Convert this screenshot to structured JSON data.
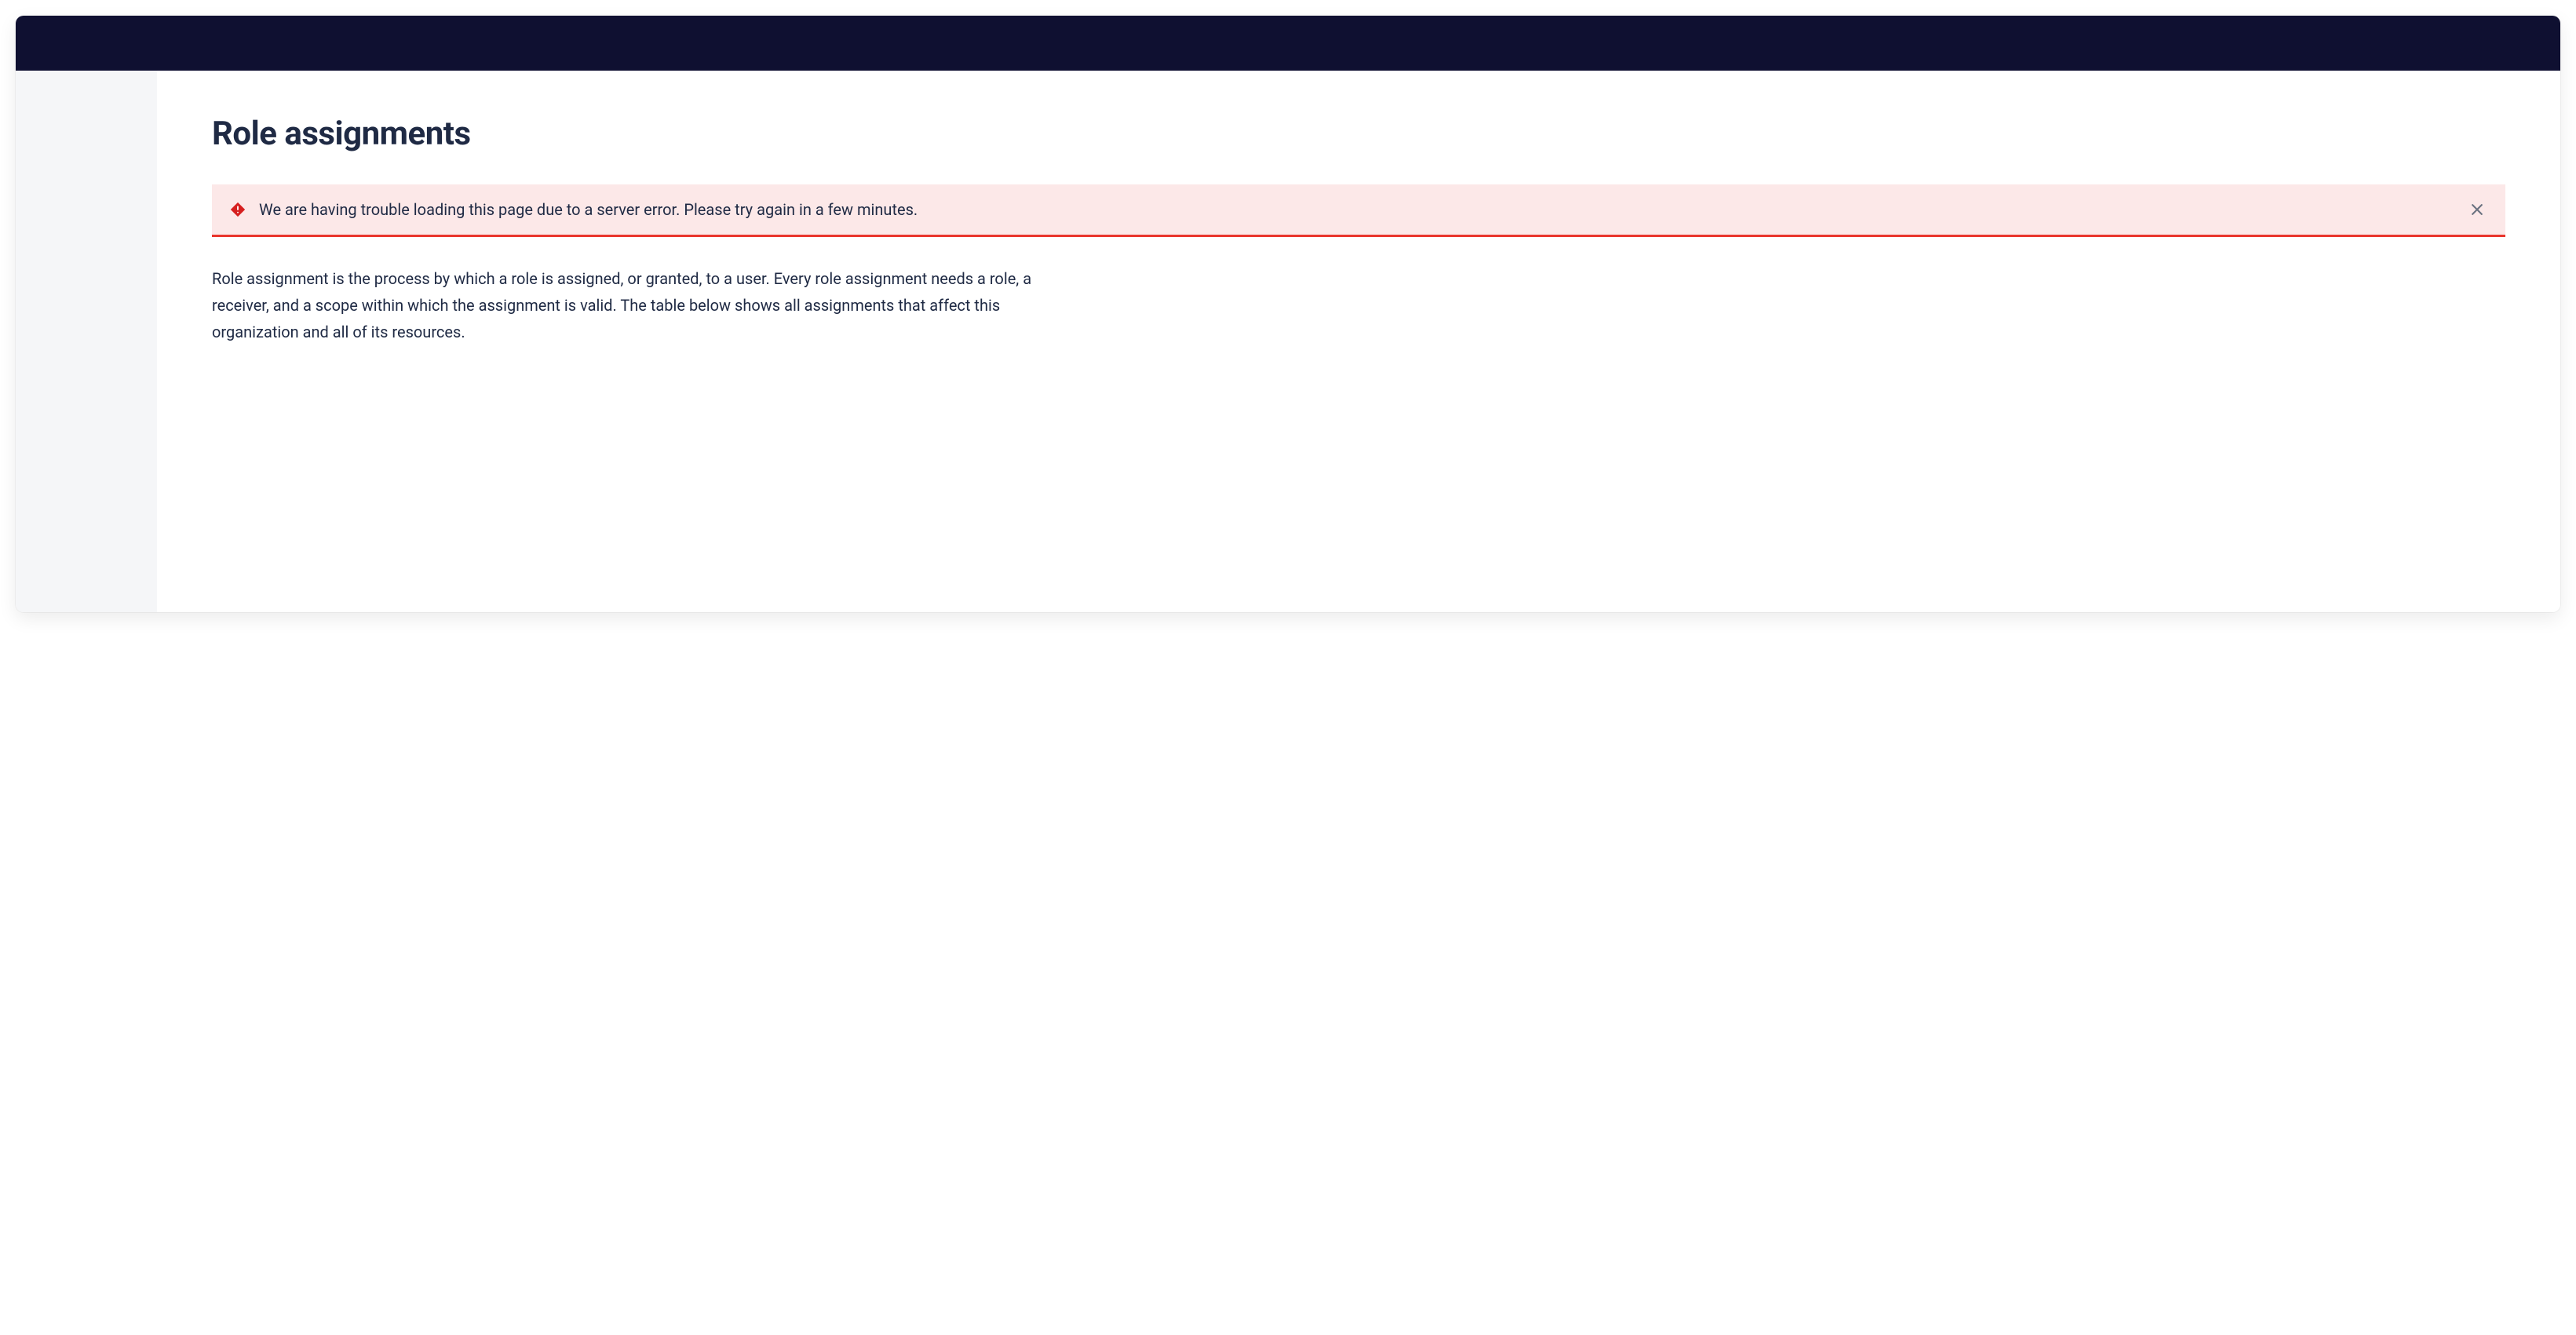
{
  "page": {
    "title": "Role assignments",
    "description": "Role assignment is the process by which a role is assigned, or granted, to a user. Every role assignment needs a role, a receiver, and a scope within which the assignment is valid. The table below shows all assignments that affect this organization and all of its resources."
  },
  "alert": {
    "message": "We are having trouble loading this page due to a server error. Please try again in a few minutes."
  }
}
